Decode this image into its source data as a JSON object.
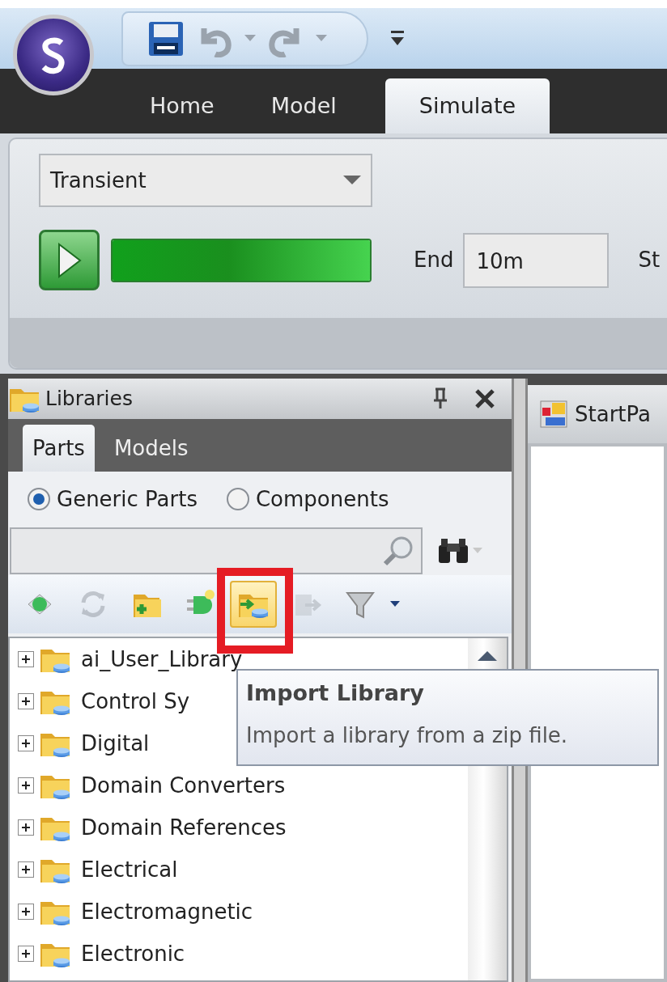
{
  "ribbon_tabs": [
    {
      "label": "Home",
      "selected": false
    },
    {
      "label": "Model",
      "selected": false
    },
    {
      "label": "Simulate",
      "selected": true
    }
  ],
  "ribbon": {
    "analysis_type": "Transient",
    "progress": {
      "level": 1
    },
    "end_label": "End",
    "end_value": "10m",
    "cut_label": "St"
  },
  "libraries_panel": {
    "title": "Libraries",
    "tabs": [
      {
        "label": "Parts",
        "selected": true
      },
      {
        "label": "Models",
        "selected": false
      }
    ],
    "radios": [
      {
        "label": "Generic Parts",
        "selected": true
      },
      {
        "label": "Components",
        "selected": false
      }
    ],
    "toolbar": [
      {
        "kind": "add-part",
        "disabled": false,
        "highlighted": false
      },
      {
        "kind": "refresh",
        "disabled": true,
        "highlighted": false
      },
      {
        "kind": "add-folder",
        "disabled": false,
        "highlighted": false
      },
      {
        "kind": "new-part",
        "disabled": false,
        "highlighted": false
      },
      {
        "kind": "import",
        "disabled": false,
        "highlighted": true
      },
      {
        "kind": "export",
        "disabled": true,
        "highlighted": false
      },
      {
        "kind": "filter",
        "disabled": false,
        "highlighted": false
      }
    ],
    "tree": [
      {
        "label": "ai_User_Library",
        "expanded": false
      },
      {
        "label": "Control Sy",
        "expanded": false
      },
      {
        "label": "Digital",
        "expanded": false
      },
      {
        "label": "Domain Converters",
        "expanded": false
      },
      {
        "label": "Domain References",
        "expanded": false
      },
      {
        "label": "Electrical",
        "expanded": false
      },
      {
        "label": "Electromagnetic",
        "expanded": false
      },
      {
        "label": "Electronic",
        "expanded": false
      }
    ]
  },
  "document_tab": {
    "title": "StartPa"
  },
  "tooltip": {
    "title": "Import Library",
    "text": "Import a library from a zip file."
  }
}
